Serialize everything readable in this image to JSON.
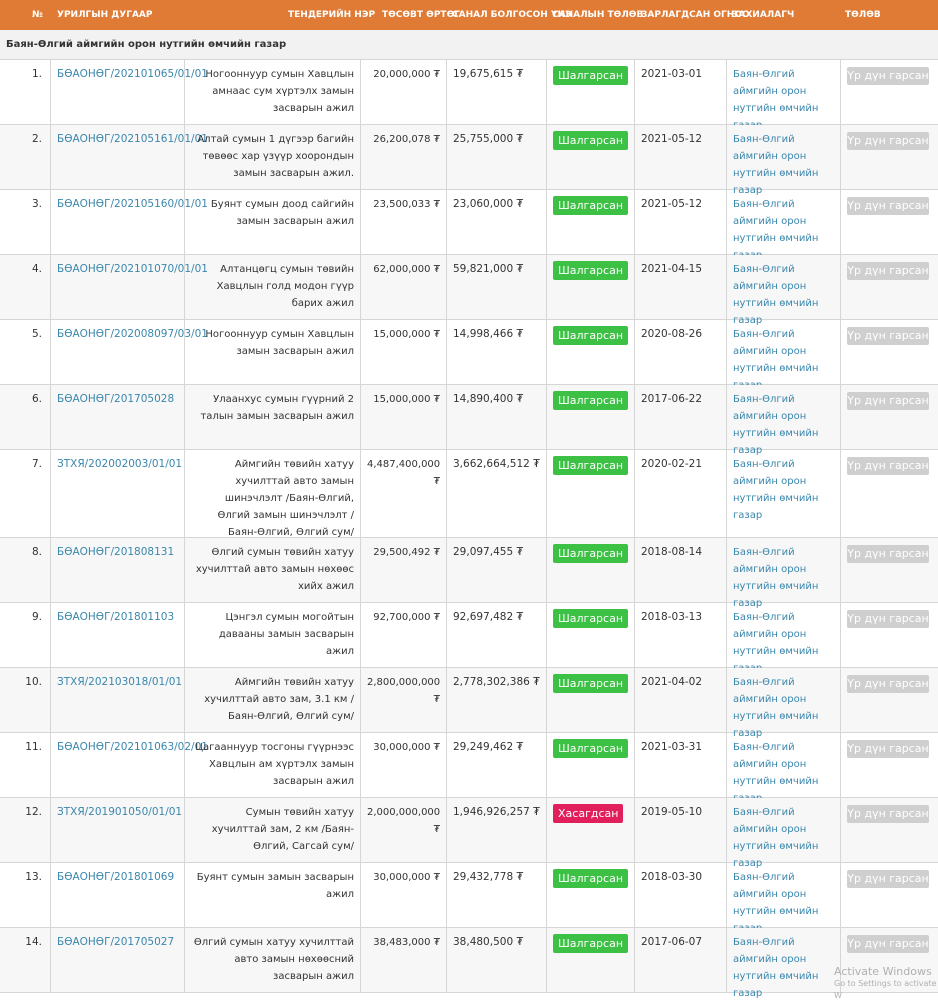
{
  "columns": [
    "№",
    "УРИЛГЫН ДУГААР",
    "ТЕНДЕРИЙН НЭР",
    "ТӨСӨВТ ӨРТӨГ",
    "САНАЛ БОЛГОСОН ҮНЭ",
    "САНАЛЫН ТӨЛӨВ",
    "ЗАРЛАГДСАН ОГНОО",
    "ЗАХИАЛАГЧ",
    "ТӨЛӨВ"
  ],
  "group_title": "Баян-Өлгий аймгийн орон нутгийн өмчийн газар",
  "rows": [
    {
      "no": "1.",
      "code": "БӨАОНӨГ/202101065/01/01",
      "name": "Ногооннуур сумын Хавцлын амнаас сум хүртэлх замын засварын ажил",
      "budget": "20,000,000 ₮",
      "offer": "19,675,615 ₮",
      "status": "Шалгарсан",
      "status_type": "ok",
      "date": "2021-03-01",
      "customer": "Баян-Өлгий аймгийн орон нутгийн өмчийн газар",
      "state": "Үр дүн гарсан"
    },
    {
      "no": "2.",
      "code": "БӨАОНӨГ/202105161/01/01",
      "name": "Алтай сумын 1 дүгээр багийн төвөөс хар үзүүр хоорондын замын засварын ажил.",
      "budget": "26,200,078 ₮",
      "offer": "25,755,000 ₮",
      "status": "Шалгарсан",
      "status_type": "ok",
      "date": "2021-05-12",
      "customer": "Баян-Өлгий аймгийн орон нутгийн өмчийн газар",
      "state": "Үр дүн гарсан"
    },
    {
      "no": "3.",
      "code": "БӨАОНӨГ/202105160/01/01",
      "name": "Буянт сумын доод сайгийн замын засварын ажил",
      "budget": "23,500,033 ₮",
      "offer": "23,060,000 ₮",
      "status": "Шалгарсан",
      "status_type": "ok",
      "date": "2021-05-12",
      "customer": "Баян-Өлгий аймгийн орон нутгийн өмчийн газар",
      "state": "Үр дүн гарсан"
    },
    {
      "no": "4.",
      "code": "БӨАОНӨГ/202101070/01/01",
      "name": "Алтанцөгц сумын төвийн Хавцлын голд модон гүүр барих ажил",
      "budget": "62,000,000 ₮",
      "offer": "59,821,000 ₮",
      "status": "Шалгарсан",
      "status_type": "ok",
      "date": "2021-04-15",
      "customer": "Баян-Өлгий аймгийн орон нутгийн өмчийн газар",
      "state": "Үр дүн гарсан"
    },
    {
      "no": "5.",
      "code": "БӨАОНӨГ/202008097/03/01",
      "name": "Ногооннуур сумын Хавцлын замын засварын ажил",
      "budget": "15,000,000 ₮",
      "offer": "14,998,466 ₮",
      "status": "Шалгарсан",
      "status_type": "ok",
      "date": "2020-08-26",
      "customer": "Баян-Өлгий аймгийн орон нутгийн өмчийн газар",
      "state": "Үр дүн гарсан"
    },
    {
      "no": "6.",
      "code": "БӨАОНӨГ/201705028",
      "name": "Улаанхус сумын гүүрний 2 талын замын засварын ажил",
      "budget": "15,000,000 ₮",
      "offer": "14,890,400 ₮",
      "status": "Шалгарсан",
      "status_type": "ok",
      "date": "2017-06-22",
      "customer": "Баян-Өлгий аймгийн орон нутгийн өмчийн газар",
      "state": "Үр дүн гарсан"
    },
    {
      "no": "7.",
      "code": "ЗТХЯ/202002003/01/01",
      "name": "Аймгийн төвийн хатуу хучилттай авто замын шинэчлэлт /Баян-Өлгий, Өлгий замын шинэчлэлт /Баян-Өлгий, Өлгий сум/",
      "budget": "4,487,400,000 ₮",
      "offer": "3,662,664,512 ₮",
      "status": "Шалгарсан",
      "status_type": "ok",
      "date": "2020-02-21",
      "customer": "Баян-Өлгий аймгийн орон нутгийн өмчийн газар",
      "state": "Үр дүн гарсан"
    },
    {
      "no": "8.",
      "code": "БӨАОНӨГ/201808131",
      "name": "Өлгий сумын төвийн хатуу хучилттай авто замын нөхөөс хийх ажил",
      "budget": "29,500,492 ₮",
      "offer": "29,097,455 ₮",
      "status": "Шалгарсан",
      "status_type": "ok",
      "date": "2018-08-14",
      "customer": "Баян-Өлгий аймгийн орон нутгийн өмчийн газар",
      "state": "Үр дүн гарсан"
    },
    {
      "no": "9.",
      "code": "БӨАОНӨГ/201801103",
      "name": "Цэнгэл сумын могойтын давааны замын засварын ажил",
      "budget": "92,700,000 ₮",
      "offer": "92,697,482 ₮",
      "status": "Шалгарсан",
      "status_type": "ok",
      "date": "2018-03-13",
      "customer": "Баян-Өлгий аймгийн орон нутгийн өмчийн газар",
      "state": "Үр дүн гарсан"
    },
    {
      "no": "10.",
      "code": "ЗТХЯ/202103018/01/01",
      "name": "Аймгийн төвийн хатуу хучилттай авто зам, 3.1 км /Баян-Өлгий, Өлгий сум/",
      "budget": "2,800,000,000 ₮",
      "offer": "2,778,302,386 ₮",
      "status": "Шалгарсан",
      "status_type": "ok",
      "date": "2021-04-02",
      "customer": "Баян-Өлгий аймгийн орон нутгийн өмчийн газар",
      "state": "Үр дүн гарсан"
    },
    {
      "no": "11.",
      "code": "БӨАОНӨГ/202101063/02/01",
      "name": "Цагааннуур тосгоны гүүрнээс Хавцлын ам хүртэлх замын засварын ажил",
      "budget": "30,000,000 ₮",
      "offer": "29,249,462 ₮",
      "status": "Шалгарсан",
      "status_type": "ok",
      "date": "2021-03-31",
      "customer": "Баян-Өлгий аймгийн орон нутгийн өмчийн газар",
      "state": "Үр дүн гарсан"
    },
    {
      "no": "12.",
      "code": "ЗТХЯ/201901050/01/01",
      "name": "Сумын төвийн хатуу хучилттай зам, 2 км /Баян-Өлгий, Сагсай сум/",
      "budget": "2,000,000,000 ₮",
      "offer": "1,946,926,257 ₮",
      "status": "Хасагдсан",
      "status_type": "bad",
      "date": "2019-05-10",
      "customer": "Баян-Өлгий аймгийн орон нутгийн өмчийн газар",
      "state": "Үр дүн гарсан"
    },
    {
      "no": "13.",
      "code": "БӨАОНӨГ/201801069",
      "name": "Буянт сумын замын засварын ажил",
      "budget": "30,000,000 ₮",
      "offer": "29,432,778 ₮",
      "status": "Шалгарсан",
      "status_type": "ok",
      "date": "2018-03-30",
      "customer": "Баян-Өлгий аймгийн орон нутгийн өмчийн газар",
      "state": "Үр дүн гарсан"
    },
    {
      "no": "14.",
      "code": "БӨАОНӨГ/201705027",
      "name": "Өлгий сумын хатуу хучилттай авто замын нөхөөсний засварын ажил",
      "budget": "38,483,000 ₮",
      "offer": "38,480,500 ₮",
      "status": "Шалгарсан",
      "status_type": "ok",
      "date": "2017-06-07",
      "customer": "Баян-Өлгий аймгийн орон нутгийн өмчийн газар",
      "state": "Үр дүн гарсан"
    }
  ],
  "watermark": {
    "line1": "Activate Windows",
    "line2": "Go to Settings to activate W"
  },
  "colors": {
    "header": "#e07b35",
    "ok": "#3cc145",
    "bad": "#e21f5d",
    "link": "#3a87ad",
    "button": "#cfcfcf"
  }
}
